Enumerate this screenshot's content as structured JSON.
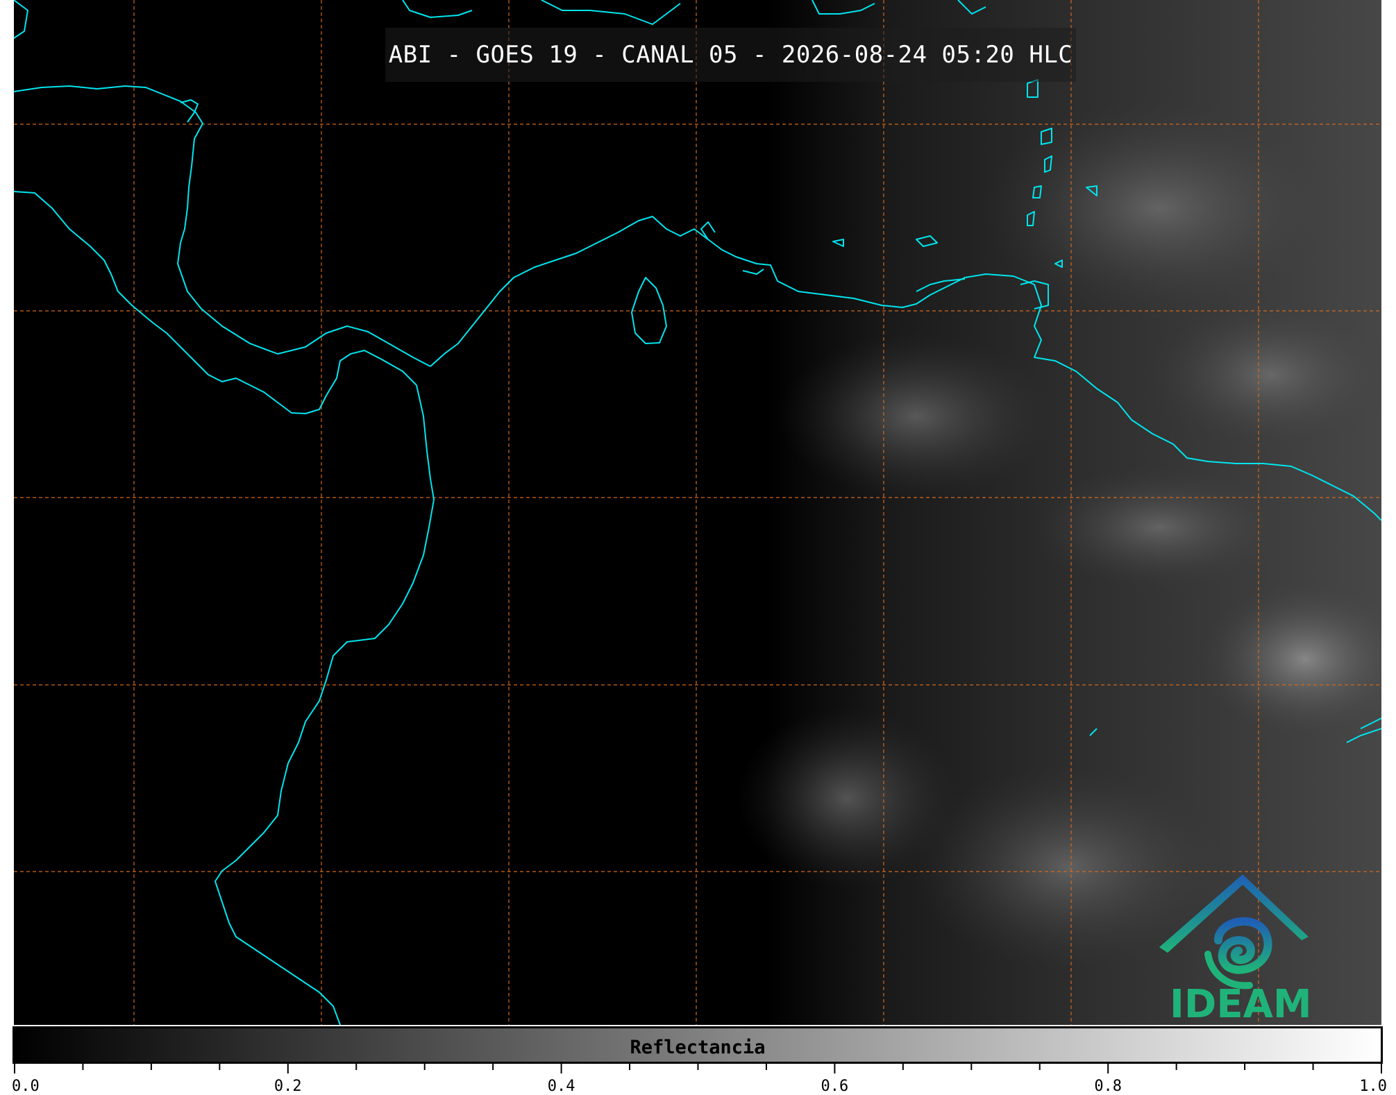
{
  "title": "ABI - GOES 19 - CANAL 05 - 2026-08-24 05:20 HLC",
  "colorbar": {
    "label": "Reflectancia",
    "min": 0.0,
    "max": 1.0,
    "tick_labels": [
      "0.0",
      "0.2",
      "0.4",
      "0.6",
      "0.8",
      "1.0"
    ],
    "colormap": [
      "#000000",
      "#ffffff"
    ]
  },
  "logo": {
    "text": "IDEAM"
  },
  "colors": {
    "coastline": "#00e5ee",
    "gridline": "#d2691e",
    "background": "#000000",
    "logo_blue": "#1f6fb5",
    "logo_green": "#1fb37a"
  }
}
